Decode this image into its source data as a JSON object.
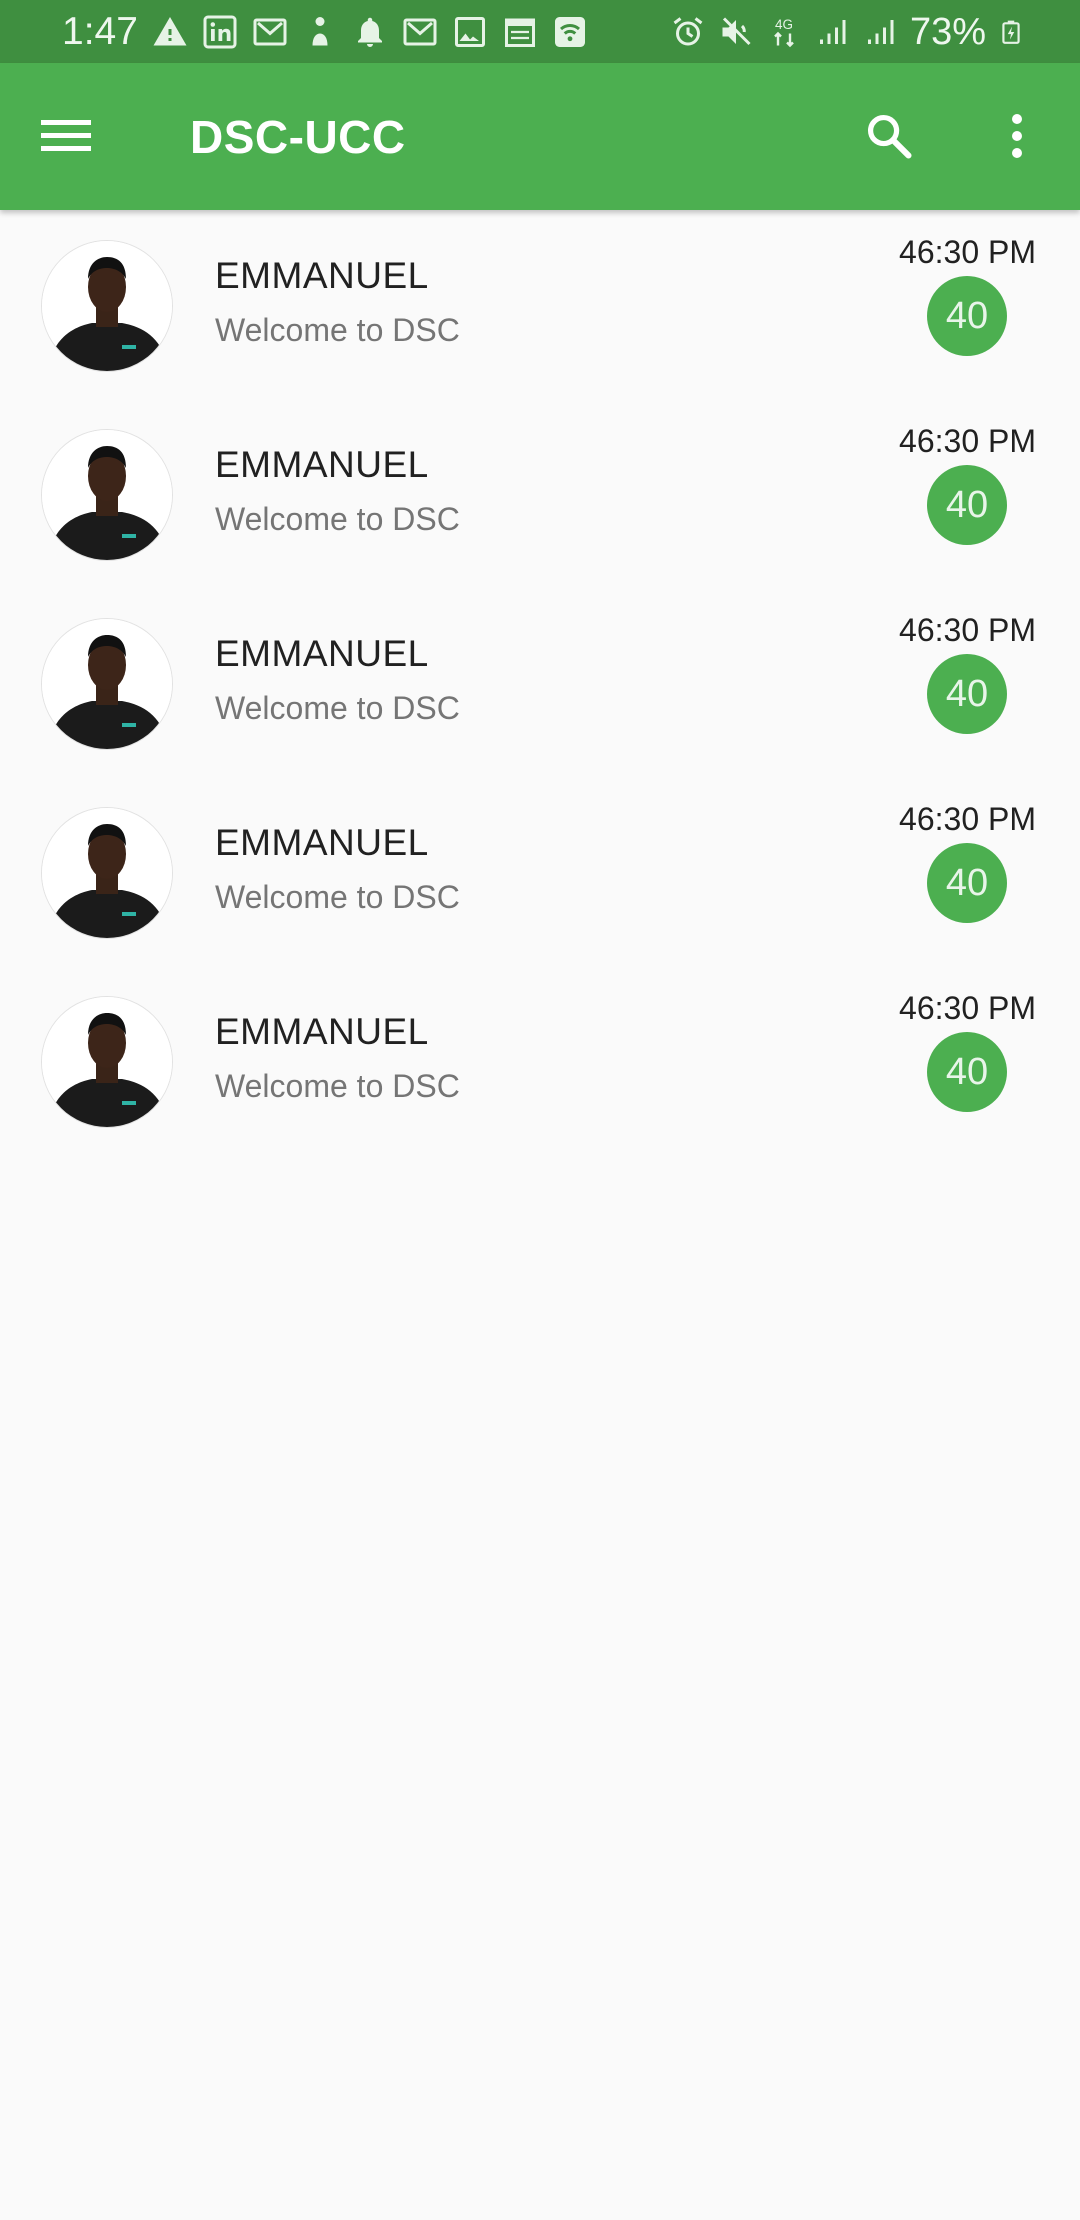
{
  "status_bar": {
    "time": "1:47",
    "battery": "73%",
    "left_icons": [
      "warning-icon",
      "linkedin-icon",
      "gmail-icon",
      "person-icon",
      "bell-icon",
      "gmail-icon",
      "image-icon",
      "calendar-icon",
      "wifi-hotspot-icon"
    ],
    "right_icons": [
      "alarm-icon",
      "mute-icon",
      "4g-icon",
      "signal-icon",
      "signal-icon",
      "battery-charging-icon"
    ]
  },
  "app_bar": {
    "title": "DSC-UCC",
    "color": "#4caf50",
    "status_color": "#3f8f40"
  },
  "chats": [
    {
      "name": "EMMANUEL",
      "message": "Welcome to DSC",
      "time": "46:30 PM",
      "unread": "40"
    },
    {
      "name": "EMMANUEL",
      "message": "Welcome to DSC",
      "time": "46:30 PM",
      "unread": "40"
    },
    {
      "name": "EMMANUEL",
      "message": "Welcome to DSC",
      "time": "46:30 PM",
      "unread": "40"
    },
    {
      "name": "EMMANUEL",
      "message": "Welcome to DSC",
      "time": "46:30 PM",
      "unread": "40"
    },
    {
      "name": "EMMANUEL",
      "message": "Welcome to DSC",
      "time": "46:30 PM",
      "unread": "40"
    }
  ]
}
